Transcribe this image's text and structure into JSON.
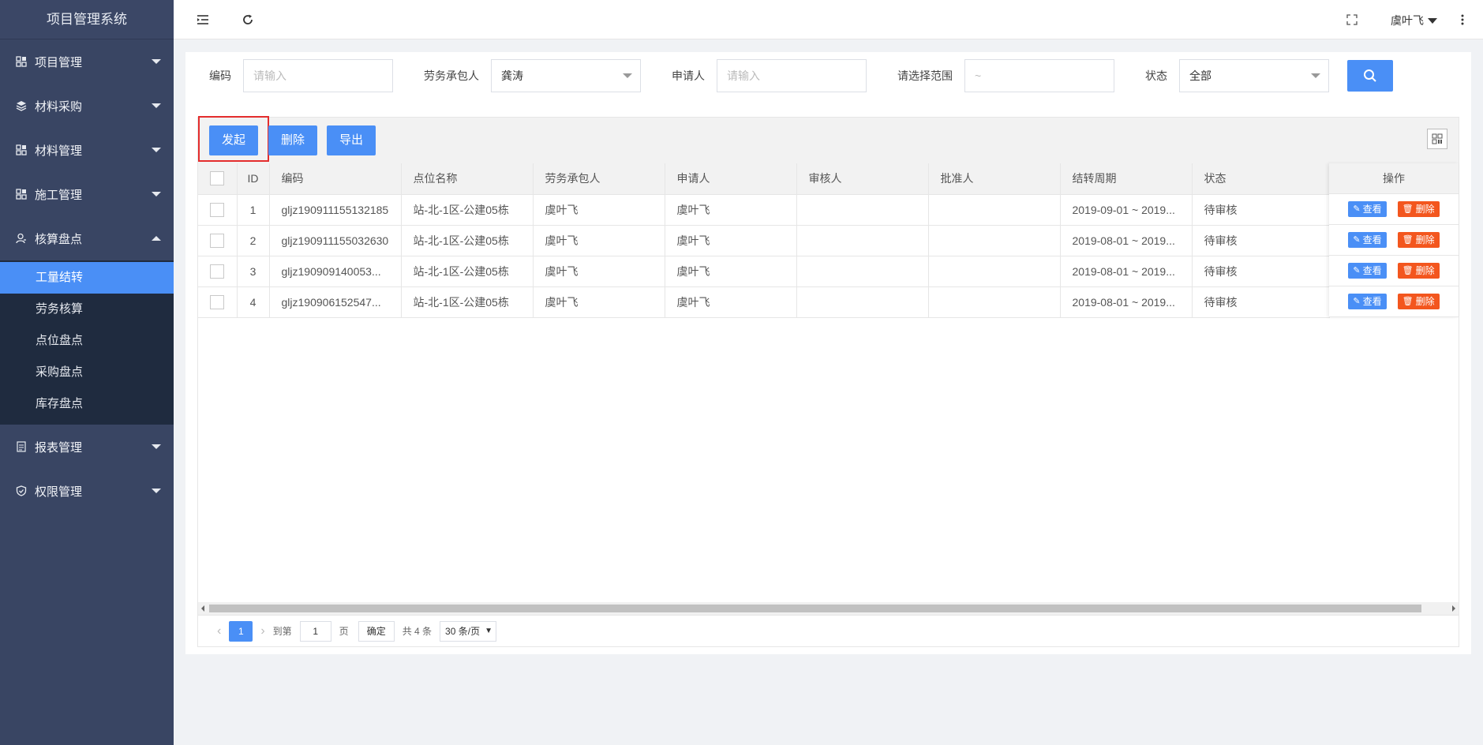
{
  "app": {
    "title": "项目管理系统"
  },
  "sidebar": {
    "items": [
      {
        "label": "项目管理",
        "icon": "apps-icon"
      },
      {
        "label": "材料采购",
        "icon": "layers-icon"
      },
      {
        "label": "材料管理",
        "icon": "apps-icon"
      },
      {
        "label": "施工管理",
        "icon": "apps-icon"
      },
      {
        "label": "核算盘点",
        "icon": "user-icon"
      },
      {
        "label": "报表管理",
        "icon": "report-icon"
      },
      {
        "label": "权限管理",
        "icon": "shield-icon"
      }
    ],
    "submenu": [
      "工量结转",
      "劳务核算",
      "点位盘点",
      "采购盘点",
      "库存盘点"
    ],
    "active_sub": "工量结转"
  },
  "header": {
    "user": "虞叶飞"
  },
  "filters": {
    "code_label": "编码",
    "code_placeholder": "请输入",
    "contractor_label": "劳务承包人",
    "contractor_value": "龚涛",
    "applicant_label": "申请人",
    "applicant_placeholder": "请输入",
    "range_label": "请选择范围",
    "range_placeholder": "~",
    "status_label": "状态",
    "status_value": "全部"
  },
  "toolbar": {
    "start": "发起",
    "delete": "删除",
    "export": "导出"
  },
  "table": {
    "columns": [
      "ID",
      "编码",
      "点位名称",
      "劳务承包人",
      "申请人",
      "审核人",
      "批准人",
      "结转周期",
      "状态",
      "操作"
    ],
    "rows": [
      {
        "id": "1",
        "code": "gljz190911155132185",
        "site": "站-北-1区-公建05栋",
        "contractor": "虞叶飞",
        "applicant": "虞叶飞",
        "reviewer": "",
        "approver": "",
        "period": "2019-09-01 ~ 2019...",
        "status": "待审核"
      },
      {
        "id": "2",
        "code": "gljz190911155032630",
        "site": "站-北-1区-公建05栋",
        "contractor": "虞叶飞",
        "applicant": "虞叶飞",
        "reviewer": "",
        "approver": "",
        "period": "2019-08-01 ~ 2019...",
        "status": "待审核"
      },
      {
        "id": "3",
        "code": "gljz190909140053...",
        "site": "站-北-1区-公建05栋",
        "contractor": "虞叶飞",
        "applicant": "虞叶飞",
        "reviewer": "",
        "approver": "",
        "period": "2019-08-01 ~ 2019...",
        "status": "待审核"
      },
      {
        "id": "4",
        "code": "gljz190906152547...",
        "site": "站-北-1区-公建05栋",
        "contractor": "虞叶飞",
        "applicant": "虞叶飞",
        "reviewer": "",
        "approver": "",
        "period": "2019-08-01 ~ 2019...",
        "status": "待审核"
      }
    ],
    "view_label": "查看",
    "delete_label": "删除"
  },
  "pager": {
    "current": "1",
    "goto_label": "到第",
    "goto_value": "1",
    "page_unit": "页",
    "confirm": "确定",
    "total": "共 4 条",
    "page_size": "30 条/页"
  },
  "colors": {
    "accent": "#4a8ff6",
    "sidebar": "#394563",
    "submenu": "#1f2b3f",
    "danger": "#f3561e",
    "highlight": "#e42d2d"
  }
}
